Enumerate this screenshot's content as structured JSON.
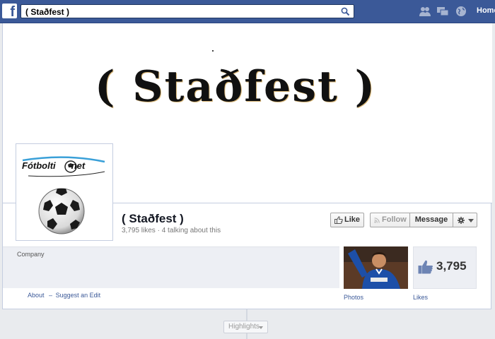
{
  "topbar": {
    "logo_letter": "f",
    "search_value": "( Staðfest )",
    "home_label": "Home",
    "icons": [
      "friend-requests-icon",
      "messages-icon",
      "notifications-globe-icon"
    ]
  },
  "cover": {
    "title": "( Staðfest )"
  },
  "profile": {
    "logo_text": "Fótbolti",
    "logo_text_suffix": "net"
  },
  "page": {
    "name": "( Staðfest )",
    "stats": "3,795 likes · 4 talking about this",
    "category": "Company"
  },
  "actions": {
    "like_label": "Like",
    "follow_label": "Follow",
    "message_label": "Message"
  },
  "about": {
    "about_label": "About",
    "separator": "–",
    "suggest_label": "Suggest an Edit"
  },
  "apps": {
    "photos_label": "Photos",
    "likes_label": "Likes",
    "likes_count": "3,795"
  },
  "timeline": {
    "highlights_label": "Highlights"
  },
  "colors": {
    "brand": "#3b5998",
    "background": "#e9ebee"
  }
}
